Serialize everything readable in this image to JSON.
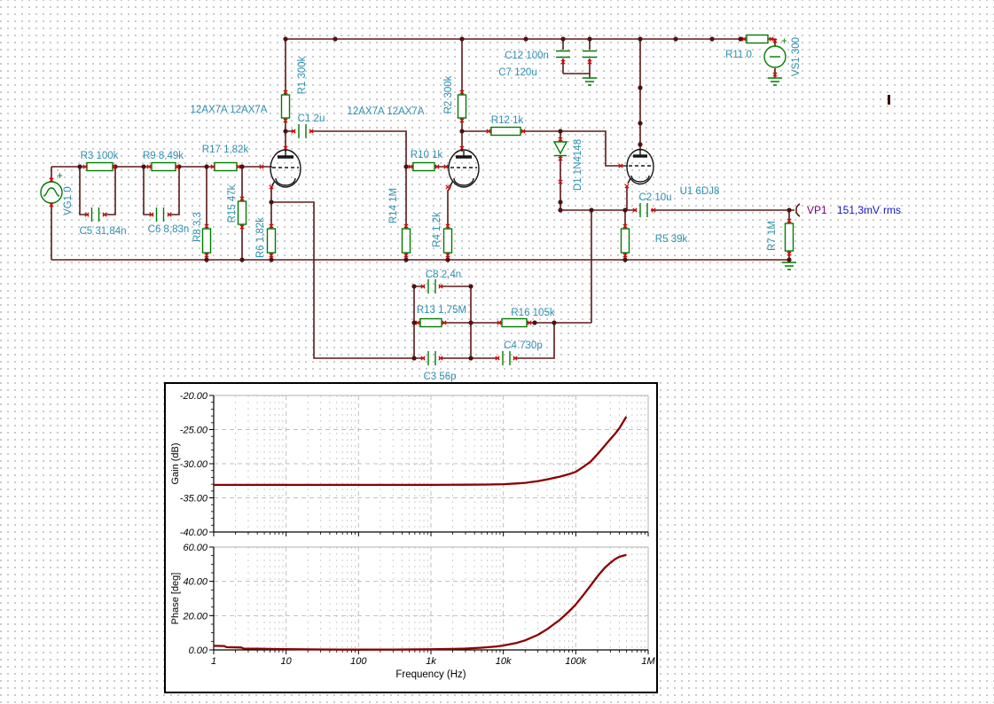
{
  "app": {
    "name": "circuit-simulator-canvas"
  },
  "schematic": {
    "labels": {
      "vg1": "VG1 0",
      "vg1_plus": "+",
      "r3": "R3 100k",
      "r9": "R9 8,49k",
      "r17": "R17 1,82k",
      "c5": "C5 31,84n",
      "c6": "C6 8,83n",
      "r8": "R8 3,3",
      "r15": "R15 47k",
      "r6": "R6 1,82k",
      "tube_pair_1": "12AX7A 12AX7A",
      "tube_pair_2": "12AX7A 12AX7A",
      "r1": "R1 300k",
      "c1": "C1 2u",
      "r10": "R10 1k",
      "r14": "R14 1M",
      "r4": "R4 1,2k",
      "r2": "R2 300k",
      "r12": "R12 1k",
      "d1": "D1 1N4148",
      "c12": "C12 100n",
      "c7": "C7 120u",
      "r11": "R11 0",
      "vs1": "VS1 300",
      "vs1_plus": "+",
      "u1": "U1 6DJ8",
      "c2": "C2 10u",
      "r5": "R5 39k",
      "r7": "R7 1M",
      "c8": "C8 2,4n",
      "r13": "R13 1,75M",
      "r16": "R16 105k",
      "c4": "C4 730p",
      "c3": "C3 56p"
    },
    "probe": {
      "name": "VP1",
      "value": "151,3mV",
      "unit": "rms"
    },
    "colors": {
      "wire": "#5e1818",
      "component": "#007c00",
      "label": "#2d8fb0",
      "pin_mark": "#e00000",
      "junction": "#4c1212",
      "tube": "#141414",
      "probe_name": "#82007e",
      "probe_value": "#1414c8"
    }
  },
  "chart_data": [
    {
      "type": "line",
      "title": "",
      "ylabel": "Gain (dB)",
      "xlabel": "",
      "xscale": "log",
      "xlim": [
        1,
        1000000
      ],
      "ylim": [
        -40,
        -20
      ],
      "yticks": [
        -20,
        -25,
        -30,
        -35,
        -40
      ],
      "ytick_labels": [
        "-20.00",
        "-25.00",
        "-30.00",
        "-35.00",
        "-40.00"
      ],
      "y_minor_step": 1,
      "xticks": [
        1,
        10,
        100,
        1000,
        10000,
        100000,
        1000000
      ],
      "xtick_labels": [
        "1",
        "10",
        "100",
        "1k",
        "10k",
        "100k",
        "1M"
      ],
      "show_xtick_labels": false,
      "grid": "on",
      "legend": "none",
      "series": [
        {
          "name": "Gain",
          "color": "#8b0000",
          "points": [
            [
              1,
              -33.1
            ],
            [
              10,
              -33.1
            ],
            [
              100,
              -33.1
            ],
            [
              1000,
              -33.1
            ],
            [
              3000,
              -33.08
            ],
            [
              6000,
              -33.05
            ],
            [
              10000,
              -33.0
            ],
            [
              15000,
              -32.9
            ],
            [
              20000,
              -32.8
            ],
            [
              30000,
              -32.55
            ],
            [
              40000,
              -32.3
            ],
            [
              60000,
              -31.9
            ],
            [
              80000,
              -31.55
            ],
            [
              100000,
              -31.2
            ],
            [
              130000,
              -30.4
            ],
            [
              160000,
              -29.7
            ],
            [
              200000,
              -28.6
            ],
            [
              250000,
              -27.4
            ],
            [
              300000,
              -26.4
            ],
            [
              350000,
              -25.6
            ],
            [
              400000,
              -24.8
            ],
            [
              450000,
              -23.9
            ],
            [
              500000,
              -23.1
            ]
          ]
        }
      ]
    },
    {
      "type": "line",
      "title": "",
      "ylabel": "Phase [deg]",
      "xlabel": "Frequency (Hz)",
      "xscale": "log",
      "xlim": [
        1,
        1000000
      ],
      "ylim": [
        0,
        60
      ],
      "yticks": [
        60,
        40,
        20,
        0
      ],
      "ytick_labels": [
        "60.00",
        "40.00",
        "20.00",
        "0.00"
      ],
      "y_minor_step": 5,
      "xticks": [
        1,
        10,
        100,
        1000,
        10000,
        100000,
        1000000
      ],
      "xtick_labels": [
        "1",
        "10",
        "100",
        "1k",
        "10k",
        "100k",
        "1M"
      ],
      "show_xtick_labels": true,
      "grid": "on",
      "legend": "none",
      "series": [
        {
          "name": "Phase",
          "color": "#8b0000",
          "points": [
            [
              1,
              2.4
            ],
            [
              1.4,
              2.3
            ],
            [
              1.5,
              1.6
            ],
            [
              2.4,
              1.4
            ],
            [
              2.6,
              0.8
            ],
            [
              5,
              0.6
            ],
            [
              8,
              0.45
            ],
            [
              10,
              0.4
            ],
            [
              30,
              0.25
            ],
            [
              100,
              0.15
            ],
            [
              300,
              0.2
            ],
            [
              1000,
              0.35
            ],
            [
              2000,
              0.55
            ],
            [
              3000,
              0.8
            ],
            [
              5000,
              1.3
            ],
            [
              8000,
              2.0
            ],
            [
              10000,
              2.6
            ],
            [
              15000,
              4.0
            ],
            [
              20000,
              5.6
            ],
            [
              30000,
              8.8
            ],
            [
              40000,
              12.0
            ],
            [
              50000,
              15.0
            ],
            [
              60000,
              17.5
            ],
            [
              80000,
              22.3
            ],
            [
              100000,
              26.5
            ],
            [
              130000,
              32.5
            ],
            [
              160000,
              37.5
            ],
            [
              200000,
              43.0
            ],
            [
              250000,
              47.8
            ],
            [
              300000,
              50.8
            ],
            [
              350000,
              53.0
            ],
            [
              400000,
              54.3
            ],
            [
              450000,
              55.0
            ],
            [
              500000,
              55.4
            ]
          ]
        }
      ]
    }
  ]
}
